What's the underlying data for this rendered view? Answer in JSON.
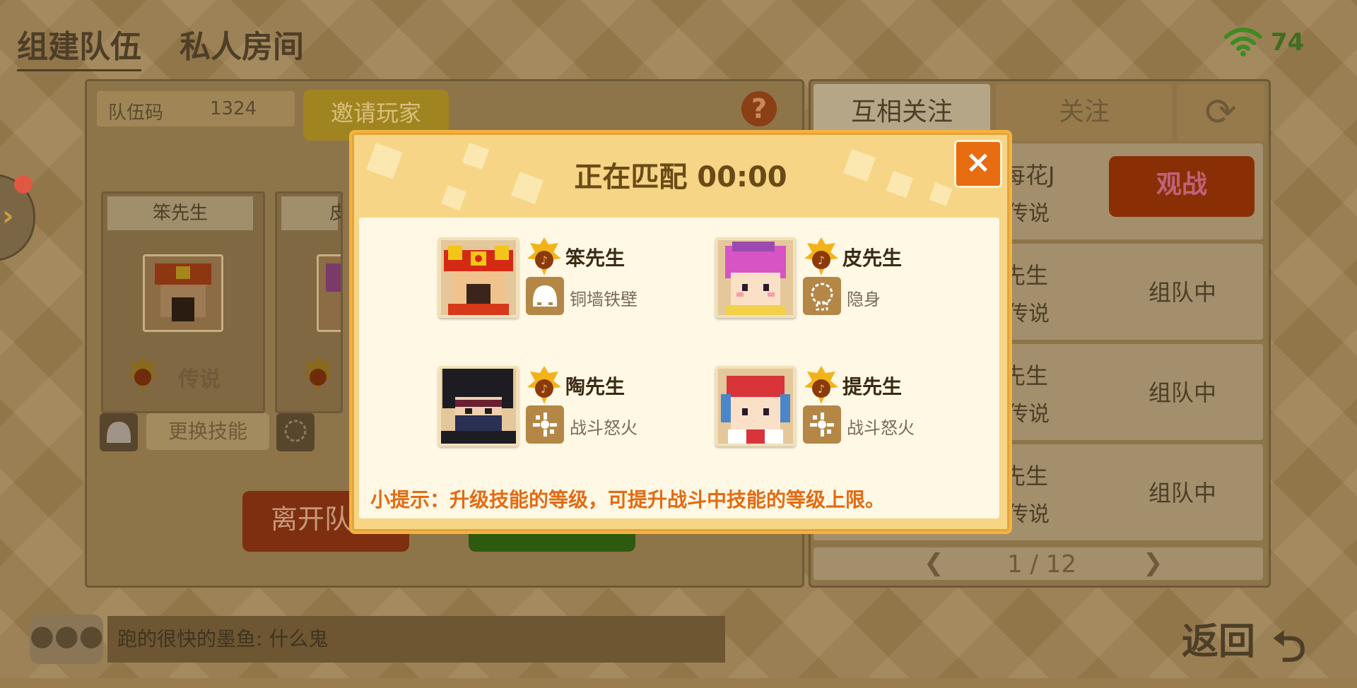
{
  "top_tabs": {
    "team": "组建队伍",
    "private_room": "私人房间"
  },
  "status": {
    "battery": "74"
  },
  "team_panel": {
    "code_label": "队伍码",
    "code_value": "1324",
    "invite_label": "邀请玩家",
    "help_label": "?",
    "member1": {
      "name": "笨先生",
      "rank": "传说"
    },
    "member2": {
      "name": "皮"
    },
    "change_skill_label": "更换技能",
    "leave_label": "离开队"
  },
  "friend_panel": {
    "tab_mutual": "互相关注",
    "tab_follow": "关注",
    "rows": [
      {
        "name": "每花J",
        "rank": "传说",
        "action": "观战"
      },
      {
        "name": "先生",
        "rank": "传说",
        "status": "组队中"
      },
      {
        "name": "先生",
        "rank": "传说",
        "status": "组队中"
      },
      {
        "name": "先生",
        "rank": "传说",
        "status": "组队中"
      }
    ],
    "page": "1 / 12"
  },
  "chat": {
    "message": "跑的很快的墨鱼: 什么鬼",
    "icon": "●●●"
  },
  "back_label": "返回",
  "modal": {
    "title": "正在匹配 00:00",
    "close_label": "×",
    "players": [
      {
        "name": "笨先生",
        "skill": "铜墙铁壁",
        "skill_icon": "helmet-icon"
      },
      {
        "name": "皮先生",
        "skill": "隐身",
        "skill_icon": "stealth-icon"
      },
      {
        "name": "陶先生",
        "skill": "战斗怒火",
        "skill_icon": "fury-icon"
      },
      {
        "name": "提先生",
        "skill": "战斗怒火",
        "skill_icon": "fury-icon"
      }
    ],
    "tip": "小提示：升级技能的等级，可提升战斗中技能的等级上限。"
  },
  "colors": {
    "accent_orange": "#e86c10",
    "modal_bg": "#f6d586",
    "tip": "#e46a12"
  }
}
